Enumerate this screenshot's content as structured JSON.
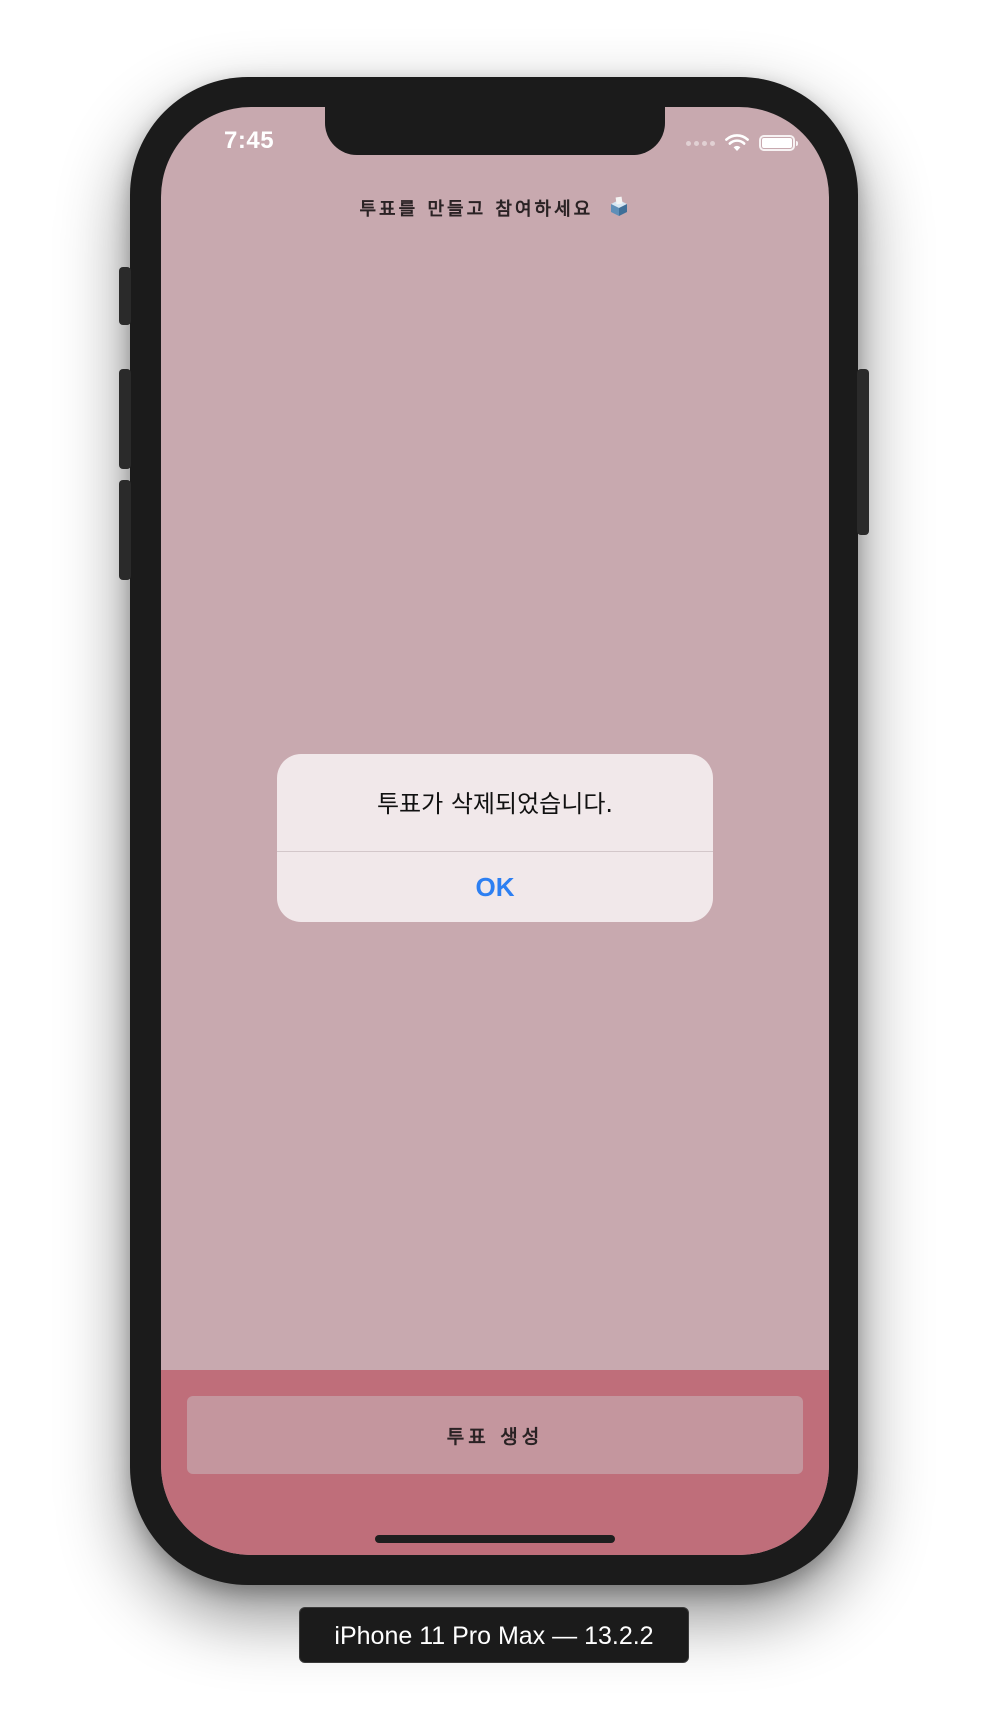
{
  "status_bar": {
    "time": "7:45",
    "icons": [
      "cellular-signal-icon",
      "wifi-icon",
      "battery-icon"
    ]
  },
  "page": {
    "title": "투표를 만들고 참여하세요",
    "title_icon": "ballot-box-icon"
  },
  "alert": {
    "message": "투표가 삭제되었습니다.",
    "ok_label": "OK"
  },
  "bottom_bar": {
    "create_button_label": "투표 생성"
  },
  "device_label": "iPhone 11 Pro Max — 13.2.2",
  "colors": {
    "screen_background": "#c8a9af",
    "bottom_bar": "#bf6e7a",
    "create_button": "#c4969e",
    "alert_background": "#f1e8ea",
    "alert_action": "#2d7ff2"
  }
}
